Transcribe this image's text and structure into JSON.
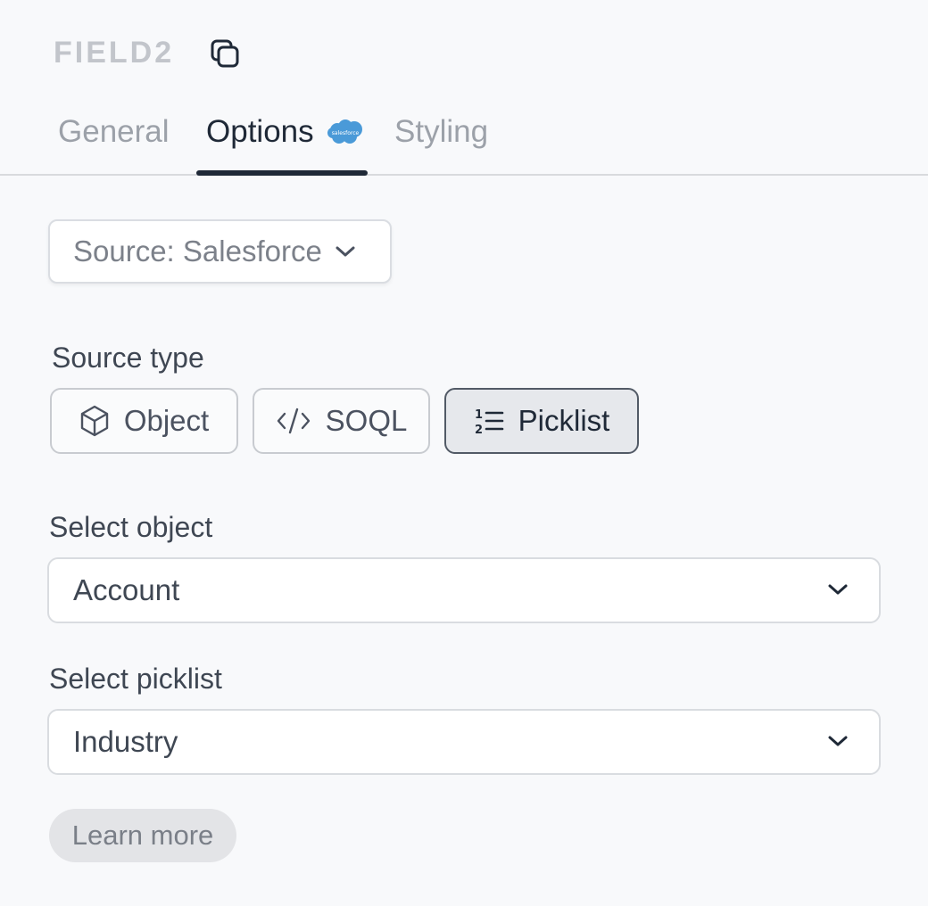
{
  "header": {
    "field_name": "FIELD2",
    "copy_icon": "copy-icon"
  },
  "tabs": [
    {
      "label": "General",
      "active": false
    },
    {
      "label": "Options",
      "active": true,
      "badge": "salesforce-logo"
    },
    {
      "label": "Styling",
      "active": false
    }
  ],
  "source_select": {
    "label": "Source: Salesforce",
    "icon": "chevron-down-icon"
  },
  "source_type": {
    "label": "Source type",
    "options": [
      {
        "label": "Object",
        "icon": "cube-icon",
        "selected": false
      },
      {
        "label": "SOQL",
        "icon": "code-icon",
        "selected": false
      },
      {
        "label": "Picklist",
        "icon": "ordered-list-icon",
        "selected": true
      }
    ]
  },
  "select_object": {
    "label": "Select object",
    "value": "Account"
  },
  "select_picklist": {
    "label": "Select picklist",
    "value": "Industry"
  },
  "learn_more_label": "Learn more",
  "colors": {
    "background": "#f8f9fb",
    "active_tab": "#1f2937",
    "inactive_tab": "#9ca1a9",
    "salesforce_blue": "#4a9ad8",
    "selected_segment_bg": "#e6e8ec"
  }
}
